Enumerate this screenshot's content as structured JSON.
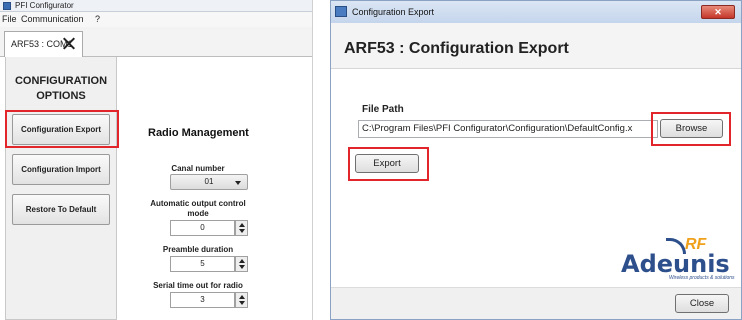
{
  "left_window": {
    "title": "PFI Configurator",
    "menu": [
      "File",
      "Communication",
      "?"
    ],
    "tab_label": "ARF53 : COM1",
    "sidebar": {
      "heading_line1": "CONFIGURATION",
      "heading_line2": "OPTIONS",
      "buttons": [
        "Configuration Export",
        "Configuration Import",
        "Restore To Default"
      ]
    },
    "radio": {
      "title": "Radio Management",
      "fields": [
        {
          "label": "Canal number",
          "value": "01",
          "kind": "select"
        },
        {
          "label_line1": "Automatic output control",
          "label_line2": "mode",
          "value": "0",
          "kind": "spinner"
        },
        {
          "label": "Preamble duration",
          "value": "5",
          "kind": "spinner"
        },
        {
          "label": "Serial time out for radio",
          "value": "3",
          "kind": "spinner"
        }
      ]
    }
  },
  "dialog": {
    "title": "Configuration Export",
    "close_glyph": "✕",
    "heading": "ARF53 : Configuration Export",
    "file_path_label": "File Path",
    "file_path_value": "C:\\Program Files\\PFI Configurator\\Configuration\\DefaultConfig.x",
    "browse_label": "Browse",
    "export_label": "Export",
    "close_label": "Close",
    "logo": {
      "brand": "Adeunis",
      "suffix": "RF",
      "tagline": "Wireless products & solutions"
    }
  },
  "colors": {
    "highlight": "#e1252a",
    "logo_blue": "#2d4f8c",
    "logo_orange": "#f0a11c"
  }
}
